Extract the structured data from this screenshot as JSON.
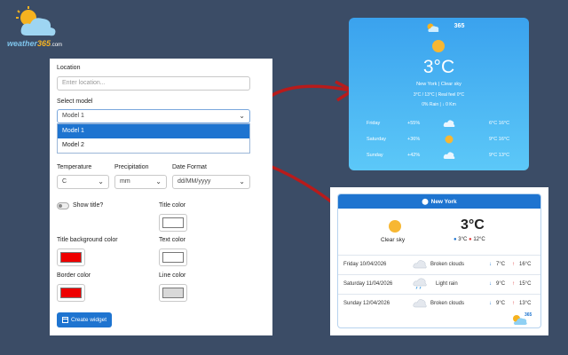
{
  "logo": {
    "brand": "weather",
    "brand_accent": "365",
    "domain": ".com"
  },
  "form": {
    "location_label": "Location",
    "location_placeholder": "Enter location...",
    "model_label": "Select model",
    "model_value": "Model 1",
    "model_options": [
      "Model 1",
      "Model 2"
    ],
    "temperature_label": "Temperature",
    "temperature_value": "C",
    "precipitation_label": "Precipitation",
    "precipitation_value": "mm",
    "date_format_label": "Date Format",
    "date_format_value": "dd/MM/yyyy",
    "show_title_label": "Show title?",
    "title_color_label": "Title color",
    "title_bg_color_label": "Title background color",
    "text_color_label": "Text color",
    "border_color_label": "Border color",
    "line_color_label": "Line color",
    "create_button": "Create widget",
    "colors": {
      "title": "#ffffff",
      "title_bg": "#ee0000",
      "text": "#ffffff",
      "border": "#ee0000",
      "line": "#d9d9d9"
    }
  },
  "widget1": {
    "logo": "365",
    "temp": "3°C",
    "location": "New York | Clear sky",
    "range": "3°C / 13°C | Real feel 0°C",
    "precip": "0% Rain | ↓ 0 Km",
    "forecast": [
      {
        "day": "Friday",
        "rain": "+55%",
        "icon": "cloud-icon",
        "range": "6°C 16°C"
      },
      {
        "day": "Saturday",
        "rain": "+36%",
        "icon": "sun-icon",
        "range": "9°C 16°C"
      },
      {
        "day": "Sunday",
        "rain": "+42%",
        "icon": "cloud-icon",
        "range": "9°C 13°C"
      }
    ]
  },
  "widget2": {
    "location": "New York",
    "current_desc": "Clear sky",
    "current_temp": "3°C",
    "current_low": "3°C",
    "current_high": "12°C",
    "forecast": [
      {
        "date": "Friday 10/04/2026",
        "desc": "Broken clouds",
        "icon": "cloud-icon",
        "low": "7°C",
        "high": "16°C"
      },
      {
        "date": "Saturday 11/04/2026",
        "desc": "Light rain",
        "icon": "rain-cloud-icon",
        "low": "9°C",
        "high": "15°C"
      },
      {
        "date": "Sunday 12/04/2026",
        "desc": "Broken clouds",
        "icon": "cloud-icon",
        "low": "9°C",
        "high": "13°C"
      }
    ],
    "logo": "365"
  }
}
